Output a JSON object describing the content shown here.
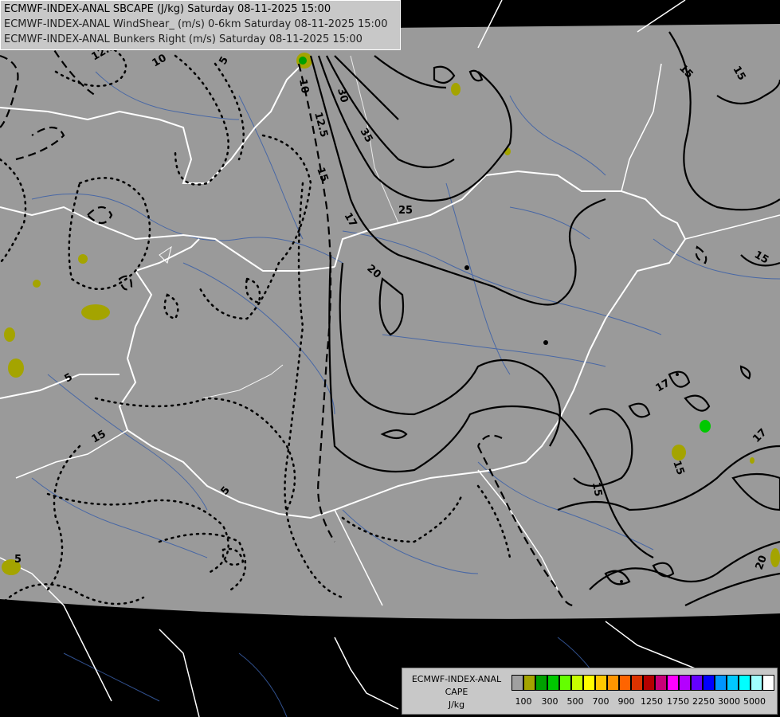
{
  "title": {
    "line1": "ECMWF-INDEX-ANAL SBCAPE (J/kg) Saturday 08-11-2025 15:00",
    "line2": "ECMWF-INDEX-ANAL WindShear_ (m/s) 0-6km Saturday 08-11-2025 15:00",
    "line3": "ECMWF-INDEX-ANAL Bunkers Right (m/s) Saturday 08-11-2025 15:00"
  },
  "legend": {
    "title1": "ECMWF-INDEX-ANAL",
    "title2": "CAPE",
    "title3": "J/kg",
    "colors": [
      "#a0a0a0",
      "#a4a400",
      "#00a000",
      "#00c800",
      "#64ff00",
      "#c8ff00",
      "#ffff00",
      "#ffc800",
      "#ff9600",
      "#ff6400",
      "#dc3200",
      "#b40000",
      "#c80078",
      "#ff00ff",
      "#b400ff",
      "#6400ff",
      "#0000ff",
      "#0096ff",
      "#00c8ff",
      "#00ffff",
      "#a0ffff",
      "#ffffff"
    ],
    "ticks": [
      "100",
      "300",
      "500",
      "700",
      "900",
      "1250",
      "1750",
      "2250",
      "3000",
      "5000"
    ]
  },
  "contour_labels": {
    "c12_5a": "12.5",
    "c10a": "10",
    "c5a": "5",
    "c30": "30",
    "c35": "35",
    "c12_5b": "12.5",
    "c15a": "15",
    "c17a": "17",
    "c25": "25",
    "c20a": "20",
    "c15b": "15",
    "c15c": "15",
    "c15d": "15",
    "c17b": "17",
    "c17c": "17",
    "c15e": "15",
    "c20b": "20",
    "c5b": "5",
    "c15f": "15",
    "c5c": "5",
    "c10b": "10",
    "c15g": "15",
    "c5d": "5"
  }
}
